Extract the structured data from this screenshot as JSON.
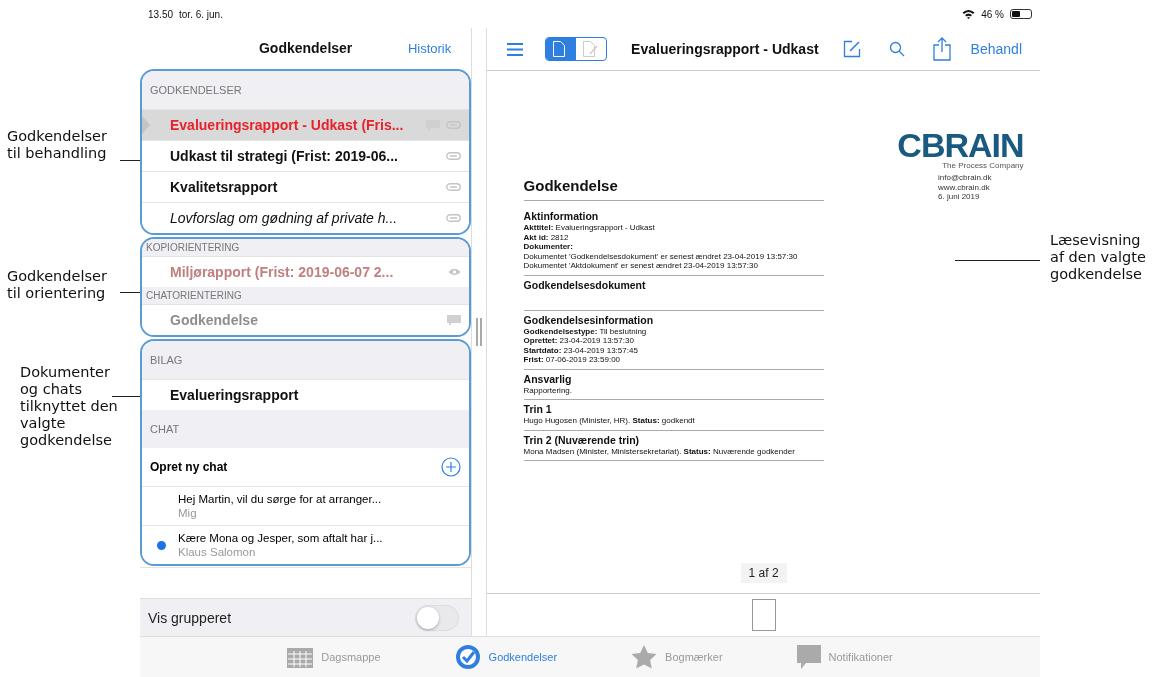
{
  "annotations_left": [
    {
      "text": "Godkendelser\ntil behandling"
    },
    {
      "text": "Godkendelser\ntil orientering"
    },
    {
      "text": "Dokumenter\nog chats\ntilknyttet den\nvalgte\ngodkendelse"
    }
  ],
  "annotation_right": {
    "text": "Læsevisning\naf den valgte\ngodkendelse"
  },
  "status_bar": {
    "time": "13.50",
    "date": "tor. 6. jun.",
    "battery": "46 %"
  },
  "left_pane": {
    "title": "Godkendelser",
    "history_link": "Historik",
    "approvals": {
      "header": "GODKENDELSER",
      "items": [
        {
          "title": "Evalueringsrapport - Udkast (Fris...",
          "selected": true,
          "italic": false,
          "comment": true
        },
        {
          "title": "Udkast til strategi (Frist: 2019-06...",
          "selected": false,
          "italic": false,
          "comment": false
        },
        {
          "title": "Kvalitetsrapport",
          "selected": false,
          "italic": false,
          "comment": false
        },
        {
          "title": "Lovforslag om gødning af private h...",
          "selected": false,
          "italic": true,
          "comment": false
        }
      ]
    },
    "orientations": [
      {
        "header": "KOPIORIENTERING",
        "item": "Miljørapport (Frist: 2019-06-07 2...",
        "kind": "copy"
      },
      {
        "header": "CHATORIENTERING",
        "item": "Godkendelse",
        "kind": "chat"
      }
    ],
    "attachments": {
      "header": "BILAG",
      "items": [
        "Evalueringsrapport"
      ]
    },
    "chat": {
      "header": "CHAT",
      "new_chat": "Opret ny chat",
      "items": [
        {
          "text": "Hej Martin, vil du sørge for at arranger...",
          "author": "Mig",
          "unread": false
        },
        {
          "text": "Kære Mona og Jesper, som aftalt har j...",
          "author": "Klaus Salomon",
          "unread": true
        }
      ]
    },
    "group_toggle": {
      "label": "Vis grupperet",
      "on": false
    }
  },
  "right_pane": {
    "title": "Evalueringsrapport - Udkast",
    "action": "Behandl",
    "view_modes": [
      {
        "kind": "read",
        "selected": true
      },
      {
        "kind": "edit",
        "selected": false
      }
    ],
    "page_counter": "1 af 2",
    "document": {
      "logo": "CBRAIN",
      "logo_tagline": "The Process Company",
      "contact": [
        "info@cbrain.dk",
        "www.cbrain.dk",
        "6. juni 2019"
      ],
      "title": "Godkendelse",
      "sections": [
        {
          "heading": "Aktinformation",
          "lines": [
            "**Akttitel:** Evalueringsrapport - Udkast",
            "**Akt id:** 2812",
            "**Dokumenter:**",
            "Dokumentet 'Godkendelsesdokument' er senest ændret 23-04-2019 13:57:30",
            "Dokumentet 'Aktdokument' er senest ændret 23-04-2019 13:57:30"
          ]
        },
        {
          "heading": "Godkendelsesdokument"
        },
        {
          "heading": "Godkendelsesinformation",
          "lines": [
            "**Godkendelsestype:** Til beslutning",
            "**Oprettet:** 23-04-2019 13:57:30",
            "**Startdato:** 23-04-2019 13:57:45",
            "**Frist:** 07-06-2019 23:59:00"
          ]
        },
        {
          "heading": "Ansvarlig",
          "lines": [
            "Rapportering."
          ]
        },
        {
          "heading": "Trin 1",
          "lines": [
            "Hugo Hugosen (Minister, HR). **Status:** godkendt"
          ]
        },
        {
          "heading": "Trin 2 (Nuværende trin)",
          "lines": [
            "Mona Madsen (Minister, Ministersekretariat). **Status:** Nuværende godkender"
          ]
        }
      ]
    }
  },
  "tab_bar": [
    {
      "label": "Dagsmappe",
      "kind": "calendar",
      "selected": false
    },
    {
      "label": "Godkendelser",
      "kind": "approval",
      "selected": true
    },
    {
      "label": "Bogmærker",
      "kind": "star",
      "selected": false
    },
    {
      "label": "Notifikationer",
      "kind": "bubble",
      "selected": false
    }
  ]
}
